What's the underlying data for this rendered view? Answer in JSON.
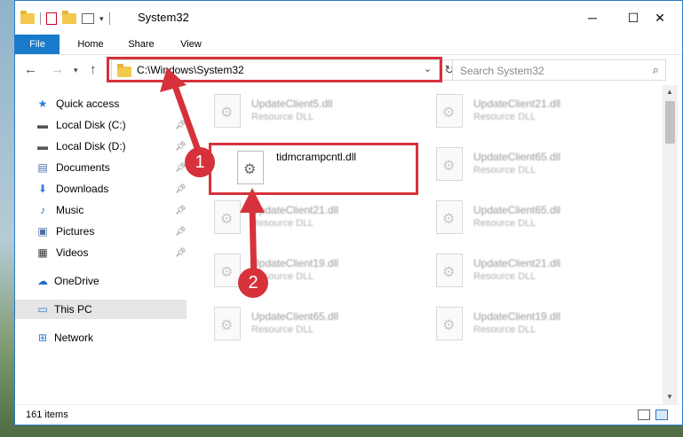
{
  "window": {
    "title": "System32",
    "controls": {
      "minimize": "─",
      "maximize": "☐",
      "close": "✕"
    }
  },
  "ribbon": {
    "tabs": [
      "File",
      "Home",
      "Share",
      "View"
    ]
  },
  "address": {
    "path": "C:\\Windows\\System32",
    "search_placeholder": "Search System32"
  },
  "nav": {
    "items": [
      {
        "label": "Quick access",
        "icon": "star-icon"
      },
      {
        "label": "Local Disk (C:)",
        "icon": "drive-icon",
        "pinned": true
      },
      {
        "label": "Local Disk (D:)",
        "icon": "drive-icon",
        "pinned": true
      },
      {
        "label": "Documents",
        "icon": "documents-icon",
        "pinned": true
      },
      {
        "label": "Downloads",
        "icon": "download-icon",
        "pinned": true
      },
      {
        "label": "Music",
        "icon": "music-icon",
        "pinned": true
      },
      {
        "label": "Pictures",
        "icon": "pictures-icon",
        "pinned": true
      },
      {
        "label": "Videos",
        "icon": "videos-icon",
        "pinned": true
      },
      {
        "label": "OneDrive",
        "icon": "cloud-icon"
      },
      {
        "label": "This PC",
        "icon": "computer-icon",
        "selected": true
      },
      {
        "label": "Network",
        "icon": "network-icon"
      }
    ]
  },
  "files": {
    "highlighted": {
      "name": "tidmcrampcntl.dll"
    },
    "tiles": [
      {
        "name": "UpdateClient5.dll",
        "type": "Resource DLL"
      },
      {
        "name": "UpdateClient21.dll",
        "type": "Resource DLL"
      },
      {
        "name": "UpdateClient65.dll",
        "type": "Resource DLL"
      },
      {
        "name": "UpdateClient21.dll",
        "type": "Resource DLL"
      },
      {
        "name": "UpdateClient65.dll",
        "type": "Resource DLL"
      },
      {
        "name": "UpdateClient19.dll",
        "type": "Resource DLL"
      },
      {
        "name": "UpdateClient21.dll",
        "type": "Resource DLL"
      },
      {
        "name": "UpdateClient65.dll",
        "type": "Resource DLL"
      },
      {
        "name": "UpdateClient19.dll",
        "type": "Resource DLL"
      }
    ]
  },
  "status": {
    "item_count": "161 items"
  },
  "annotations": {
    "step1": "1",
    "step2": "2",
    "color": "#d6323b"
  }
}
